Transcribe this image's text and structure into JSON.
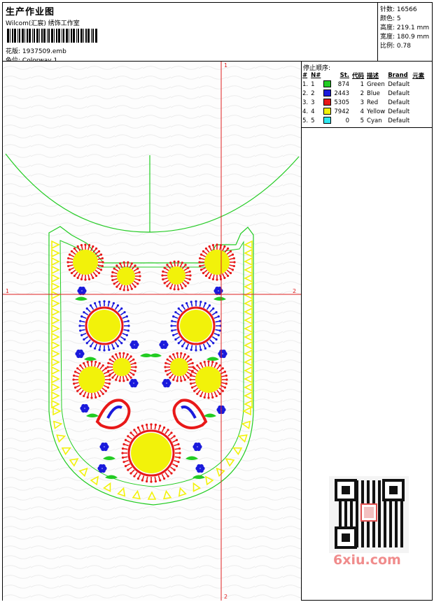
{
  "header": {
    "title": "生产作业图",
    "company": "Wilcom(汇宸) 绣饰工作室",
    "design_file_label": "花版:",
    "design_file": "1937509.emb",
    "colorway_label": "色位:",
    "colorway": "Colorway 1"
  },
  "stats": {
    "stitches_label": "针数:",
    "stitches": "16566",
    "colors_label": "颜色:",
    "colors": "5",
    "height_label": "高度:",
    "height": "219.1 mm",
    "width_label": "宽度:",
    "width": "180.9 mm",
    "scale_label": "比例:",
    "scale": "0.78"
  },
  "stop_sequence": {
    "title": "停止顺序:",
    "columns": [
      "#",
      "N#",
      "St.",
      "代码",
      "描述",
      "Brand",
      "元素"
    ],
    "rows": [
      {
        "idx": "1.",
        "n": "1",
        "color": "#22cc22",
        "st": "874",
        "code": "1",
        "desc": "Green",
        "brand": "Default"
      },
      {
        "idx": "2.",
        "n": "2",
        "color": "#1a1adc",
        "st": "2443",
        "code": "2",
        "desc": "Blue",
        "brand": "Default"
      },
      {
        "idx": "3.",
        "n": "3",
        "color": "#e81818",
        "st": "5305",
        "code": "3",
        "desc": "Red",
        "brand": "Default"
      },
      {
        "idx": "4.",
        "n": "4",
        "color": "#f2f20a",
        "st": "7942",
        "code": "4",
        "desc": "Yellow",
        "brand": "Default"
      },
      {
        "idx": "5.",
        "n": "5",
        "color": "#30e8f0",
        "st": "0",
        "code": "5",
        "desc": "Cyan",
        "brand": "Default"
      }
    ]
  },
  "axis_labels": {
    "top": "1",
    "bottom": "2",
    "left": "1",
    "right": "2"
  },
  "watermark": "6xiu.com",
  "thread_colors": {
    "green": "#22cc22",
    "blue": "#1a1adc",
    "red": "#e81818",
    "yellow": "#f2f20a",
    "guide": "#e02020"
  }
}
